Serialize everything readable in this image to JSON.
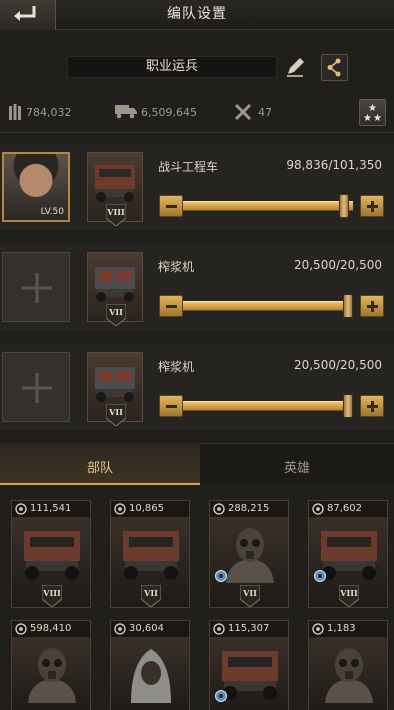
{
  "header": {
    "title": "编队设置"
  },
  "squad": {
    "name": "职业运兵"
  },
  "stats": {
    "power": "784,032",
    "load": "6,509,645",
    "wrench": "47"
  },
  "rows": [
    {
      "hero_level": "LV.50",
      "unit_name": "战斗工程车",
      "count": "98,836/101,350",
      "rank": "VIII",
      "fill": 0.975
    },
    {
      "unit_name": "榨浆机",
      "count": "20,500/20,500",
      "rank": "VII",
      "fill": 1.0
    },
    {
      "unit_name": "榨浆机",
      "count": "20,500/20,500",
      "rank": "VII",
      "fill": 1.0
    }
  ],
  "tabs": {
    "troops": "部队",
    "heroes": "英雄"
  },
  "grid": [
    {
      "count": "111,541",
      "rank": "VIII",
      "kind": "truck",
      "gear": false
    },
    {
      "count": "10,865",
      "rank": "VII",
      "kind": "truck",
      "gear": false
    },
    {
      "count": "288,215",
      "rank": "VII",
      "kind": "soldier",
      "gear": true
    },
    {
      "count": "87,602",
      "rank": "VIII",
      "kind": "truck",
      "gear": true
    },
    {
      "count": "598,410",
      "rank": "",
      "kind": "soldier",
      "gear": false
    },
    {
      "count": "30,604",
      "rank": "",
      "kind": "hooded",
      "gear": false
    },
    {
      "count": "115,307",
      "rank": "",
      "kind": "truck",
      "gear": true
    },
    {
      "count": "1,183",
      "rank": "",
      "kind": "soldier",
      "gear": false
    }
  ]
}
